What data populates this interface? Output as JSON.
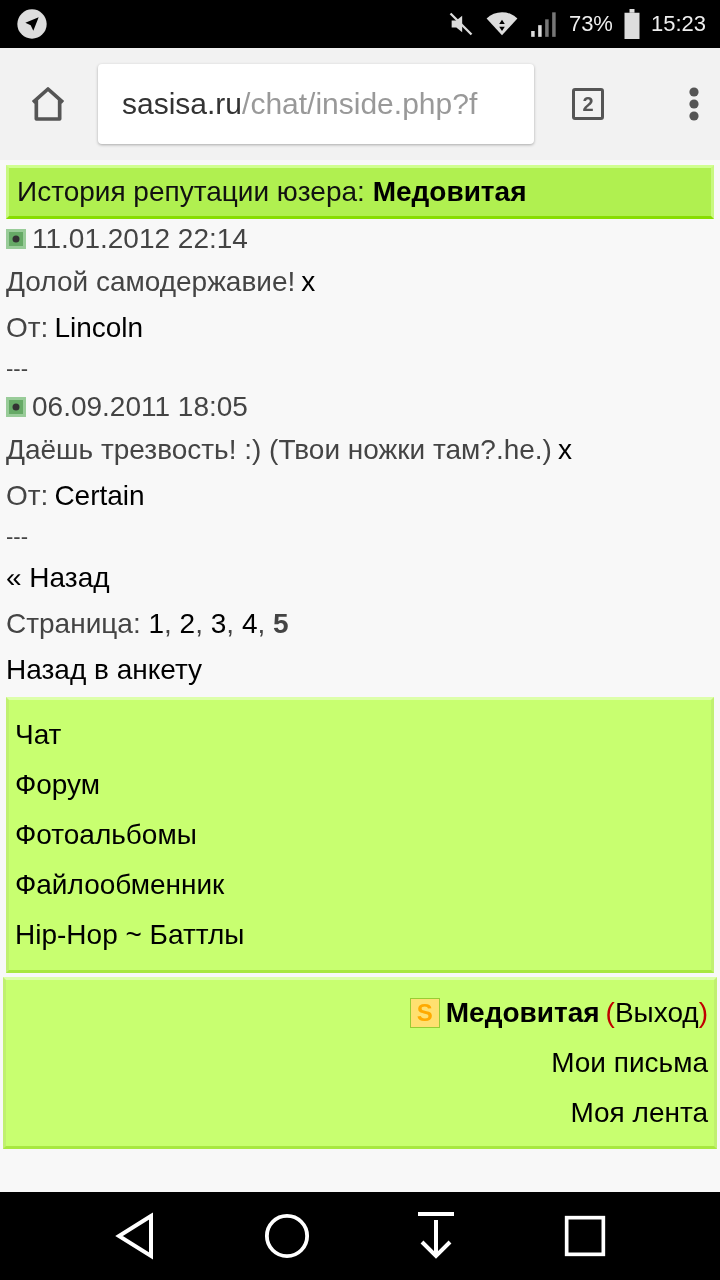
{
  "status_bar": {
    "battery": "73%",
    "time": "15:23"
  },
  "browser": {
    "url_domain": "sasisa.ru",
    "url_path": "/chat/inside.php?f",
    "tab_count": "2"
  },
  "header": {
    "label": "История репутации юзера:",
    "user": "Медовитая"
  },
  "entries": [
    {
      "date": "11.01.2012 22:14",
      "message": "Долой самодержавие!",
      "delete": "x",
      "from_label": "От:",
      "author": "Lincoln",
      "separator": "---"
    },
    {
      "date": "06.09.2011 18:05",
      "message": "Даёшь трезвость! :) (Твои ножки там?.he.)",
      "delete": "x",
      "from_label": "От:",
      "author": "Certain",
      "separator": "---"
    }
  ],
  "back_link": "« Назад",
  "pagination": {
    "label": "Страница:",
    "separator": ",",
    "pages": [
      {
        "label": "1",
        "selected": false
      },
      {
        "label": "2",
        "selected": false
      },
      {
        "label": "3",
        "selected": false
      },
      {
        "label": "4",
        "selected": false
      },
      {
        "label": "5",
        "selected": true
      }
    ]
  },
  "profile_link": "Назад в анкету",
  "menu": [
    "Чат",
    "Форум",
    "Фотоальбомы",
    "Файлообменник",
    "Hip-Hop ~ Баттлы"
  ],
  "user_panel": {
    "badge": "S",
    "name": "Медовитая",
    "open_paren": "(",
    "logout": "Выход",
    "close_paren": ")",
    "links": [
      "Мои письма",
      "Моя лента"
    ]
  }
}
